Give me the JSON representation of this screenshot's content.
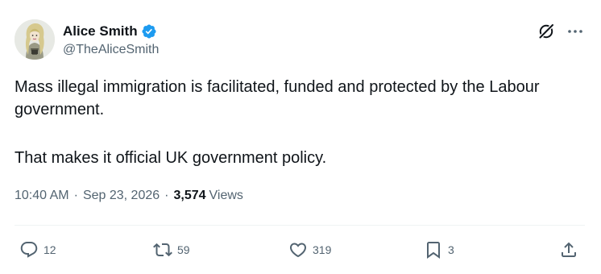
{
  "author": {
    "display_name": "Alice Smith",
    "handle": "@TheAliceSmith",
    "verified": true,
    "verified_color": "#1d9bf0"
  },
  "tweet": {
    "paragraphs": [
      "Mass illegal immigration is facilitated, funded and protected by the Labour government.",
      "That makes it official UK government policy."
    ],
    "time": "10:40 AM",
    "date": "Sep 23, 2026",
    "separator": "·",
    "views_count": "3,574",
    "views_label": "Views"
  },
  "actions": {
    "replies": "12",
    "retweets": "59",
    "likes": "319",
    "bookmarks": "3"
  },
  "icons": [
    "grok-icon",
    "more-icon",
    "reply-icon",
    "retweet-icon",
    "like-icon",
    "bookmark-icon",
    "share-icon",
    "verified-badge-icon"
  ],
  "colors": {
    "text_primary": "#0f1419",
    "text_secondary": "#536471",
    "divider": "#eff3f4"
  }
}
